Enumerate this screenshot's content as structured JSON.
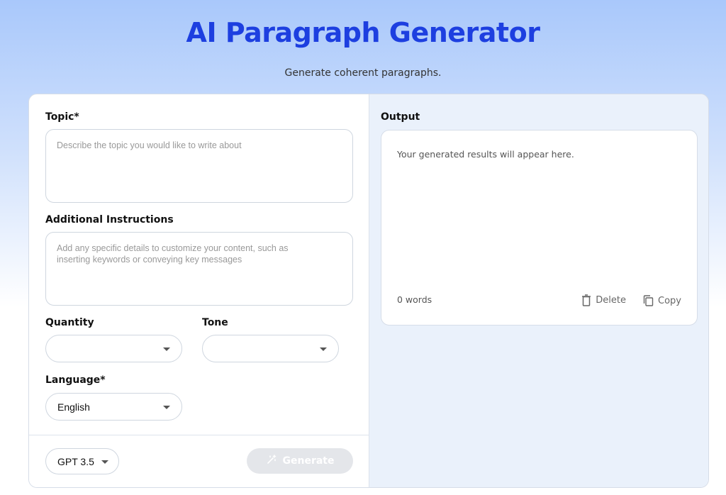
{
  "header": {
    "title": "AI Paragraph Generator",
    "subtitle": "Generate coherent paragraphs."
  },
  "form": {
    "topic": {
      "label": "Topic*",
      "placeholder": "Describe the topic you would like to write about"
    },
    "instructions": {
      "label": "Additional Instructions",
      "placeholder": "Add any specific details to customize your content, such as\ninserting keywords or conveying key messages"
    },
    "quantity": {
      "label": "Quantity",
      "value": ""
    },
    "tone": {
      "label": "Tone",
      "value": ""
    },
    "language": {
      "label": "Language*",
      "value": "English"
    }
  },
  "footer": {
    "model": "GPT 3.5",
    "generate_label": "Generate",
    "generate_icon": "magic-wand-icon"
  },
  "output": {
    "label": "Output",
    "placeholder": "Your generated results will appear here.",
    "word_count": "0 words",
    "delete_label": "Delete",
    "delete_icon": "trash-icon",
    "copy_label": "Copy",
    "copy_icon": "copy-icon"
  },
  "colors": {
    "title": "#1d3fe0",
    "output_panel_bg": "#eaf1fb",
    "generate_disabled_bg": "#e4e6ea"
  }
}
